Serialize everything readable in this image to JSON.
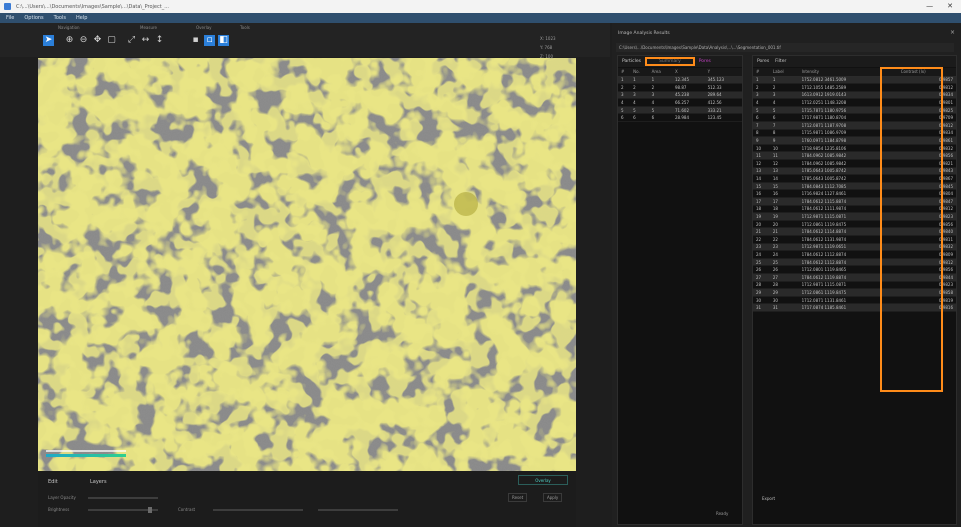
{
  "window": {
    "title": "C:\\...\\Users\\...\\Documents\\Images\\Sample\\...\\Data\\_Project_...",
    "minimize": "—",
    "close": "✕"
  },
  "menu": [
    "File",
    "Options",
    "Tools",
    "Help"
  ],
  "toolbar": {
    "groups": [
      "Navigation",
      "Measure",
      "Overlay",
      "Tools"
    ],
    "buttons": [
      {
        "name": "pointer-tool-icon",
        "glyph": "➤",
        "style": "blue"
      },
      {
        "name": "zoom-in-icon",
        "glyph": "⊕",
        "style": ""
      },
      {
        "name": "zoom-out-icon",
        "glyph": "⊖",
        "style": ""
      },
      {
        "name": "pan-tool-icon",
        "glyph": "✥",
        "style": ""
      },
      {
        "name": "fit-view-icon",
        "glyph": "▢",
        "style": ""
      },
      {
        "name": "line-tool-icon",
        "glyph": "⤢",
        "style": ""
      },
      {
        "name": "distance-tool-icon",
        "glyph": "↔",
        "style": ""
      },
      {
        "name": "height-tool-icon",
        "glyph": "↕",
        "style": ""
      },
      {
        "name": "image-tool-icon",
        "glyph": "▪",
        "style": ""
      },
      {
        "name": "select-tool-icon",
        "glyph": "▫",
        "style": "blue"
      },
      {
        "name": "mask-tool-icon",
        "glyph": "◧",
        "style": "blue"
      }
    ],
    "coords": [
      "X: 1023",
      "Y: 768",
      "Z: 100"
    ]
  },
  "viewer": {
    "colors": {
      "background": "#8e8e8e",
      "overlay": "#c9c23a",
      "overlay_edge": "#e5dd4a",
      "scalebar": "#20b0c0"
    }
  },
  "viewer_footer": {
    "tabs": [
      "Edit",
      "Layers"
    ],
    "rows": [
      "Layer Opacity",
      "Brightness",
      "Contrast"
    ],
    "buttons": [
      "Reset",
      "Apply"
    ],
    "teal_label": "Overlay"
  },
  "right_panel": {
    "header": "Image Analysis Results",
    "path": "C:\\Users\\...\\Documents\\Images\\Sample\\Data\\Analysis\\...\\...\\Segmentation_001.tif",
    "left_tabs": [
      "Particles",
      "Summary",
      "Pores"
    ],
    "right_tabs": [
      "Pores",
      "Filter"
    ],
    "left_table": {
      "columns": [
        "#",
        "No.",
        "Area",
        "X",
        "Y"
      ],
      "rows": [
        [
          "1",
          "1",
          "1",
          "12.345",
          "345.123"
        ],
        [
          "2",
          "2",
          "2",
          "98.87",
          "512.33"
        ],
        [
          "3",
          "3",
          "3",
          "45.238",
          "289.64"
        ],
        [
          "4",
          "4",
          "4",
          "66.257",
          "412.56"
        ],
        [
          "5",
          "5",
          "5",
          "71.602",
          "333.21"
        ],
        [
          "6",
          "6",
          "6",
          "28.984",
          "123.45"
        ]
      ]
    },
    "right_table": {
      "columns": [
        "#",
        "Label",
        "Intensity",
        "Contrast (lx)"
      ],
      "rows": [
        [
          "1",
          "1",
          "1752.0812 3461.5009",
          "0.9857"
        ],
        [
          "2",
          "2",
          "1712.1055 1485.2589",
          "0.9812"
        ],
        [
          "3",
          "3",
          "1613.0912 1919.0143",
          "0.9834"
        ],
        [
          "4",
          "4",
          "1712.0251 1148.3208",
          "0.9801"
        ],
        [
          "5",
          "5",
          "1715.7871 1180.9756",
          "0.9825"
        ],
        [
          "6",
          "6",
          "1717.9871 1180.8704",
          "0.9709"
        ],
        [
          "7",
          "7",
          "1712.0871 1187.9708",
          "0.9812"
        ],
        [
          "8",
          "8",
          "1715.9871 1086.9709",
          "0.9834"
        ],
        [
          "9",
          "9",
          "1760.0971 1184.8798",
          "0.9861"
        ],
        [
          "10",
          "10",
          "1718.9854 1235.8106",
          "0.9832"
        ],
        [
          "11",
          "11",
          "1784.0962 1085.9842",
          "0.9856"
        ],
        [
          "12",
          "12",
          "1784.0962 1085.9842",
          "0.9821"
        ],
        [
          "13",
          "13",
          "1785.0643 1005.8742",
          "0.9843"
        ],
        [
          "14",
          "14",
          "1785.0643 1005.8742",
          "0.9867"
        ],
        [
          "15",
          "15",
          "1784.0843 1112.7085",
          "0.9845"
        ],
        [
          "16",
          "16",
          "1716.9824 1127.8461",
          "0.9804"
        ],
        [
          "17",
          "17",
          "1784.0612 1115.8874",
          "0.9847"
        ],
        [
          "18",
          "18",
          "1784.0612 1111.9874",
          "0.9812"
        ],
        [
          "19",
          "19",
          "1712.9871 1115.0871",
          "0.9823"
        ],
        [
          "20",
          "20",
          "1712.0861 1119.8475",
          "0.9856"
        ],
        [
          "21",
          "21",
          "1784.0612 1114.8874",
          "0.9840"
        ],
        [
          "22",
          "22",
          "1784.0612 1131.9874",
          "0.9811"
        ],
        [
          "23",
          "23",
          "1712.9871 1119.0651",
          "0.9832"
        ],
        [
          "24",
          "24",
          "1784.0612 1112.8874",
          "0.9809"
        ],
        [
          "25",
          "25",
          "1784.0612 1112.8874",
          "0.9812"
        ],
        [
          "26",
          "26",
          "1712.0801 1119.8465",
          "0.9856"
        ],
        [
          "27",
          "27",
          "1784.0612 1119.8874",
          "0.9844"
        ],
        [
          "28",
          "28",
          "1712.9871 1115.0871",
          "0.9823"
        ],
        [
          "29",
          "29",
          "1712.0861 1119.8475",
          "0.9858"
        ],
        [
          "30",
          "30",
          "1712.0871 1131.8461",
          "0.9819"
        ],
        [
          "31",
          "31",
          "1717.0874 1185.8461",
          "0.9816"
        ]
      ]
    },
    "footer_label": "Export",
    "status": "Ready"
  }
}
